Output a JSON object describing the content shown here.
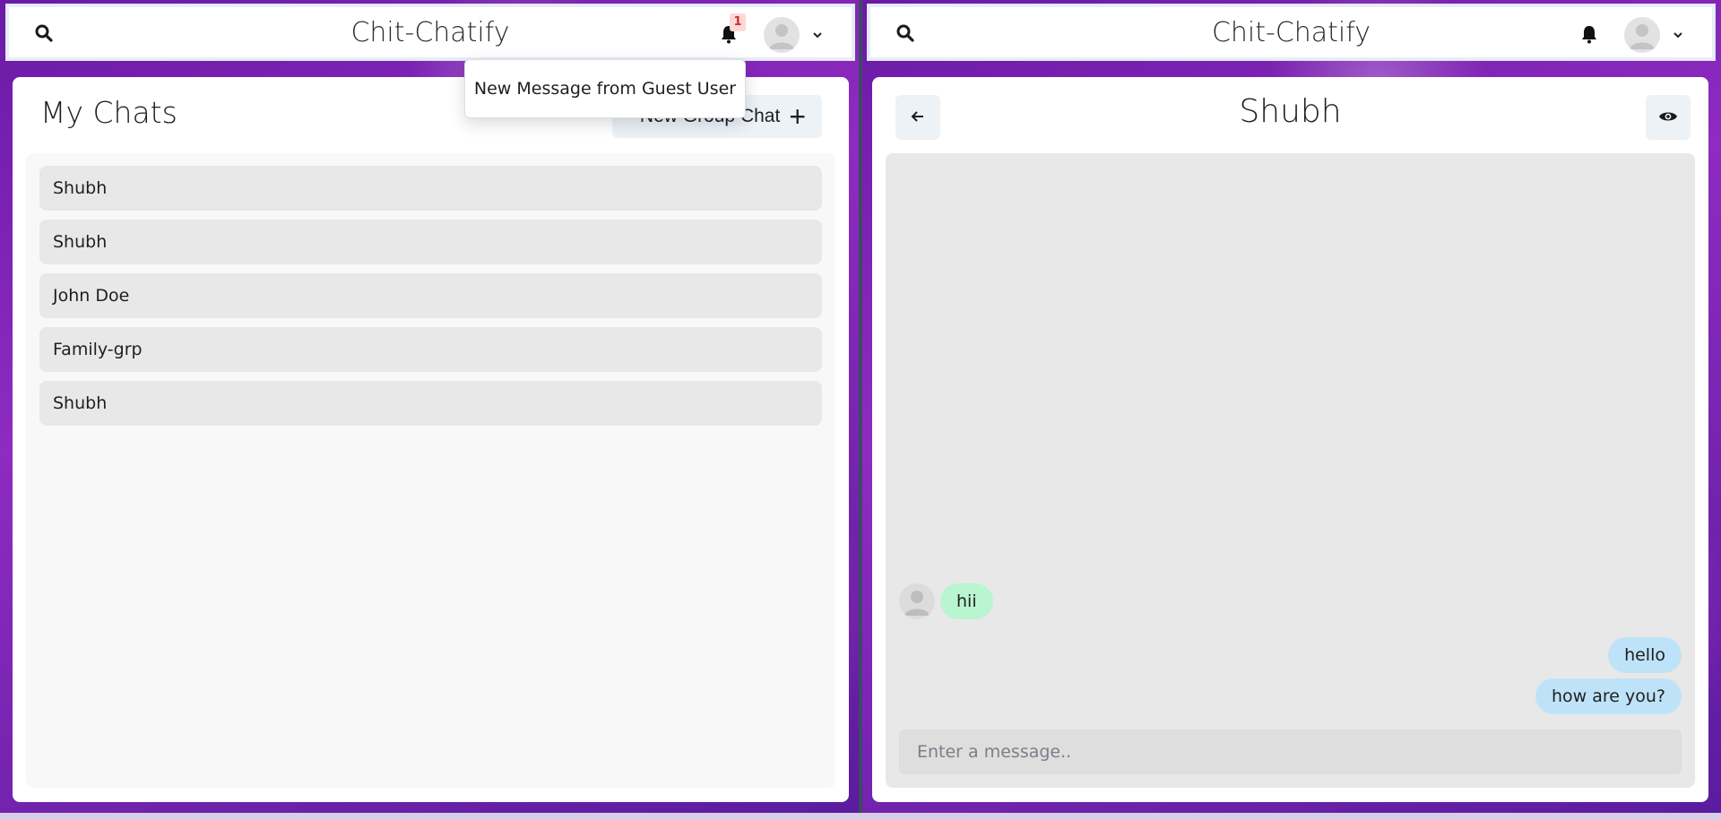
{
  "app": {
    "brand": "Chit-Chatify"
  },
  "colors": {
    "accent_bg": "#edf2f7",
    "badge_bg": "#fed7d7",
    "badge_fg": "#c53030",
    "bubble_in": "#b9f5d0",
    "bubble_out": "#bee3f8"
  },
  "left": {
    "notification_count": "1",
    "toast_text": "New Message from Guest User",
    "title": "My Chats",
    "new_group_label": "New Group Chat",
    "chats": [
      {
        "name": "Shubh"
      },
      {
        "name": "Shubh"
      },
      {
        "name": "John Doe"
      },
      {
        "name": "Family-grp"
      },
      {
        "name": "Shubh"
      }
    ]
  },
  "right": {
    "chat_title": "Shubh",
    "messages": [
      {
        "text": "hii",
        "direction": "in"
      },
      {
        "text": "hello",
        "direction": "out"
      },
      {
        "text": "how are you?",
        "direction": "out"
      }
    ],
    "input_placeholder": "Enter a message.."
  },
  "icons": [
    "search-icon",
    "bell-icon",
    "avatar-icon",
    "chevron-down-icon",
    "plus-icon",
    "arrow-left-icon",
    "eye-icon"
  ]
}
